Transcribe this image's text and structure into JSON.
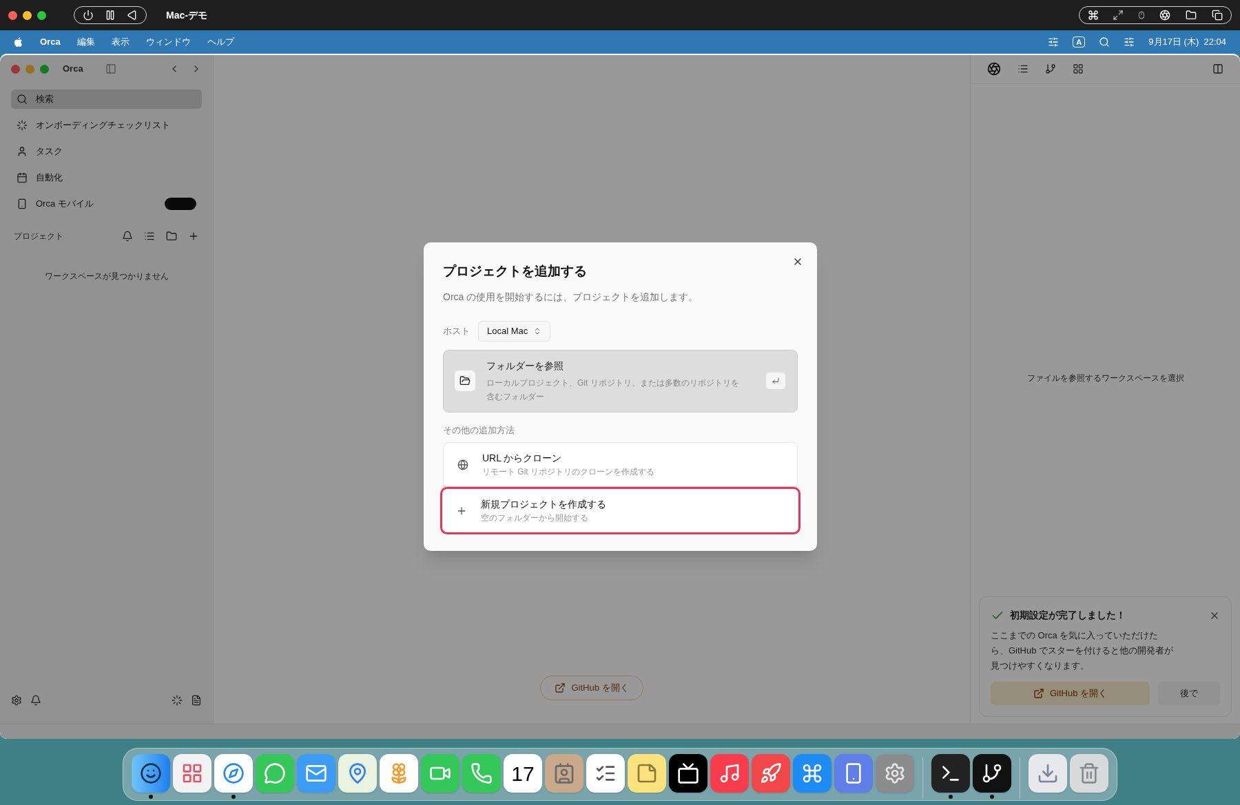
{
  "vm_bar": {
    "title": "Mac-デモ"
  },
  "menu_bar": {
    "app": "Orca",
    "items": [
      "編集",
      "表示",
      "ウィンドウ",
      "ヘルプ"
    ],
    "input_mode": "A",
    "clock": "9月17日 (木)  22:04"
  },
  "window": {
    "title": "Orca"
  },
  "sidebar": {
    "items": [
      {
        "label": "検索",
        "selected": true,
        "kind": "search"
      },
      {
        "label": "オンボーディングチェックリスト",
        "selected": false,
        "kind": "progress"
      },
      {
        "label": "タスク",
        "selected": false,
        "kind": "task"
      },
      {
        "label": "自動化",
        "selected": false,
        "kind": "calendar"
      },
      {
        "label": "Orca モバイル",
        "selected": false,
        "kind": "phone"
      }
    ],
    "projects_heading": "プロジェクト",
    "empty_text": "ワークスペースが見つかりません"
  },
  "center": {
    "github_button": "GitHub を開く"
  },
  "right_panel": {
    "empty_text": "ファイルを参照するワークスペースを選択"
  },
  "toast": {
    "title": "初期設定が完了しました！",
    "body": "ここまでの Orca を気に入っていただけたら、GitHub でスターを付けると他の開発者が見つけやすくなります。",
    "primary": "GitHub を開く",
    "secondary": "後で"
  },
  "dialog": {
    "title": "プロジェクトを追加する",
    "subtitle": "Orca の使用を開始するには、プロジェクトを追加します。",
    "host_label": "ホスト",
    "host_value": "Local Mac",
    "primary_option": {
      "title": "フォルダーを参照",
      "description": "ローカルプロジェクト、Git リポジトリ、または多数のリポジトリを含むフォルダー"
    },
    "other_heading": "その他の追加方法",
    "options": [
      {
        "kind": "globe",
        "title": "URL からクローン",
        "description": "リモート Git リポジトリのクローンを作成する",
        "highlighted": false
      },
      {
        "kind": "plus",
        "title": "新規プロジェクトを作成する",
        "description": "空のフォルダーから開始する",
        "highlighted": true
      }
    ]
  },
  "dock": [
    {
      "kind": "finder",
      "running": true
    },
    {
      "kind": "launchpad",
      "running": false
    },
    {
      "kind": "safari",
      "running": true
    },
    {
      "kind": "messages",
      "running": false
    },
    {
      "kind": "mail",
      "running": false
    },
    {
      "kind": "maps",
      "running": false
    },
    {
      "kind": "photos",
      "running": false
    },
    {
      "kind": "facetime",
      "running": false
    },
    {
      "kind": "phone",
      "running": false
    },
    {
      "kind": "calendar",
      "running": false,
      "label": "17"
    },
    {
      "kind": "contacts",
      "running": false
    },
    {
      "kind": "reminders",
      "running": false
    },
    {
      "kind": "notes",
      "running": false
    },
    {
      "kind": "tv",
      "running": false
    },
    {
      "kind": "music",
      "running": false
    },
    {
      "kind": "rocket",
      "running": false
    },
    {
      "kind": "appstore",
      "running": false
    },
    {
      "kind": "simulator",
      "running": false
    },
    {
      "kind": "settings",
      "running": false
    },
    {
      "kind": "separator"
    },
    {
      "kind": "terminal",
      "running": true
    },
    {
      "kind": "orca",
      "running": true
    },
    {
      "kind": "separator"
    },
    {
      "kind": "downloads",
      "running": false
    },
    {
      "kind": "trash",
      "running": false
    }
  ]
}
